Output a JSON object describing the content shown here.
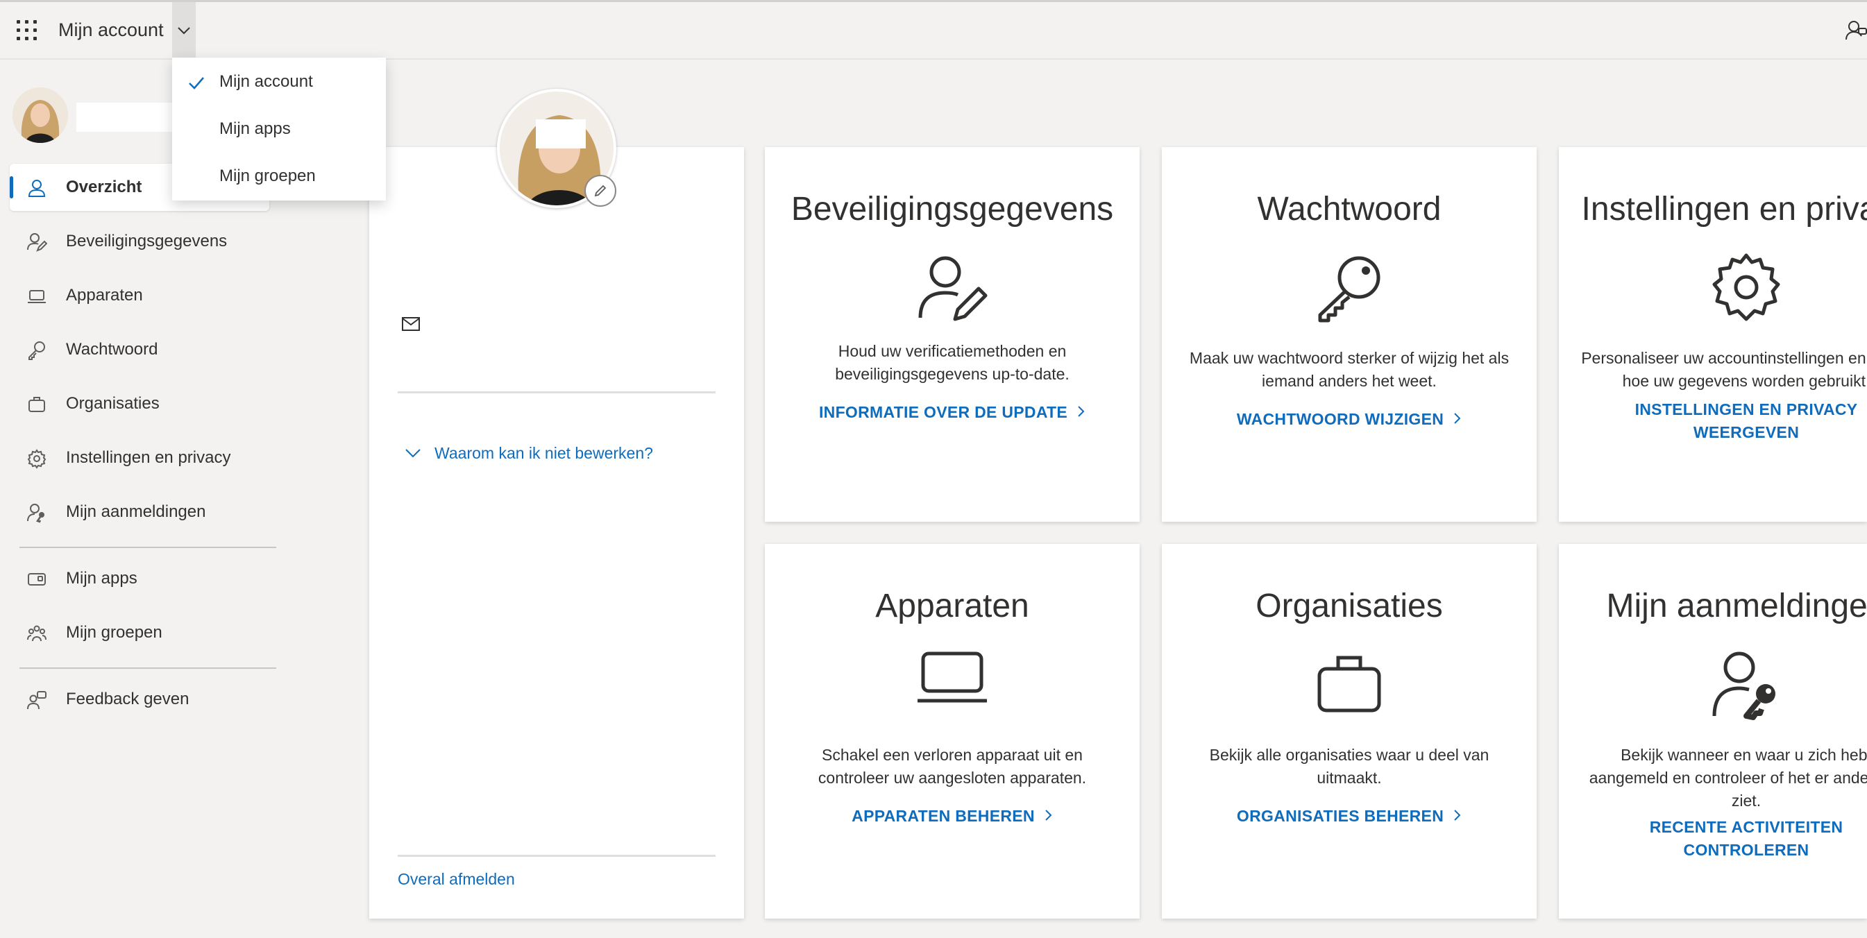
{
  "header": {
    "app_title": "Mijn account",
    "menu": [
      {
        "label": "Mijn account",
        "selected": true
      },
      {
        "label": "Mijn apps",
        "selected": false
      },
      {
        "label": "Mijn groepen",
        "selected": false
      }
    ]
  },
  "sidebar": {
    "items": [
      {
        "label": "Overzicht",
        "icon": "person-icon",
        "active": true
      },
      {
        "label": "Beveiligingsgegevens",
        "icon": "person-edit-icon"
      },
      {
        "label": "Apparaten",
        "icon": "laptop-icon"
      },
      {
        "label": "Wachtwoord",
        "icon": "key-icon"
      },
      {
        "label": "Organisaties",
        "icon": "briefcase-icon"
      },
      {
        "label": "Instellingen en privacy",
        "icon": "gear-icon"
      },
      {
        "label": "Mijn aanmeldingen",
        "icon": "person-key-icon"
      }
    ],
    "apps": [
      {
        "label": "Mijn apps",
        "icon": "apps-icon"
      },
      {
        "label": "Mijn groepen",
        "icon": "groups-icon"
      }
    ],
    "feedback": {
      "label": "Feedback geven",
      "icon": "feedback-icon"
    }
  },
  "profile_card": {
    "why_link": "Waarom kan ik niet bewerken?",
    "signout_link": "Overal afmelden"
  },
  "tiles": [
    {
      "title": "Beveiligingsgegevens",
      "icon": "person-edit-icon",
      "description": [
        "Houd uw verificatiemethoden en",
        "beveiligingsgegevens up-to-date."
      ],
      "link": [
        "INFORMATIE OVER DE UPDATE"
      ]
    },
    {
      "title": "Wachtwoord",
      "icon": "key-icon",
      "description": [
        "Maak uw wachtwoord sterker of wijzig het als",
        "iemand anders het weet."
      ],
      "link": [
        "WACHTWOORD WIJZIGEN"
      ]
    },
    {
      "title": "Instellingen en privacy",
      "icon": "gear-icon",
      "description": [
        "Personaliseer uw accountinstellingen en bekijk",
        "hoe uw gegevens worden gebruikt."
      ],
      "link": [
        "INSTELLINGEN EN PRIVACY",
        "WEERGEVEN"
      ]
    },
    {
      "title": "Apparaten",
      "icon": "laptop-icon",
      "description": [
        "Schakel een verloren apparaat uit en",
        "controleer uw aangesloten apparaten."
      ],
      "link": [
        "APPARATEN BEHEREN"
      ]
    },
    {
      "title": "Organisaties",
      "icon": "briefcase-icon",
      "description": [
        "Bekijk alle organisaties waar u deel van",
        "uitmaakt."
      ],
      "link": [
        "ORGANISATIES BEHEREN"
      ]
    },
    {
      "title": "Mijn aanmeldingen",
      "icon": "person-key-icon",
      "description": [
        "Bekijk wanneer en waar u zich hebt",
        "aangemeld en controleer of het er anders uit",
        "ziet."
      ],
      "link": [
        "RECENTE ACTIVITEITEN",
        "CONTROLEREN"
      ]
    }
  ],
  "colors": {
    "accent": "#0f6cbd",
    "background": "#f3f2f1",
    "text": "#323130"
  }
}
